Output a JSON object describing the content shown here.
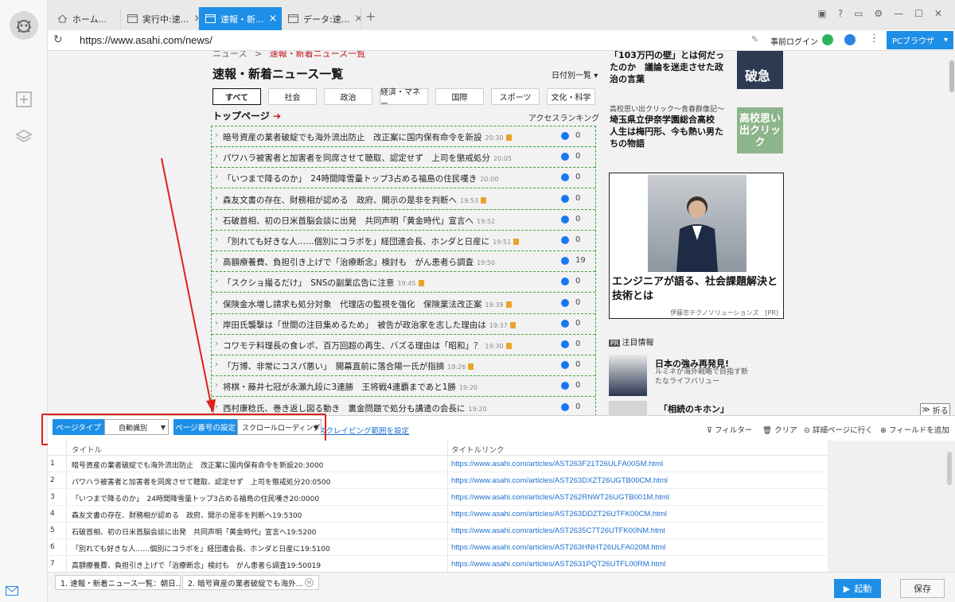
{
  "browser": {
    "tabs": [
      {
        "label": "ホーム..."
      },
      {
        "label": "実行中:速..."
      },
      {
        "label": "速報・新..."
      },
      {
        "label": "データ:速..."
      }
    ],
    "url": "https://www.asahi.com/news/",
    "login_label": "事前ログイン",
    "browser_mode_label": "PCブラウザ"
  },
  "page": {
    "breadcrumb": "ニュース",
    "breadcrumb_sep": ">",
    "breadcrumb_current": "速報・新着ニュース一覧",
    "title": "速報・新着ニュース一覧",
    "date_select": "日付別一覧",
    "categories": [
      "すべて",
      "社会",
      "政治",
      "経済・マネー",
      "国際",
      "スポーツ",
      "文化・科学"
    ],
    "top_heading": "トップページ",
    "access_ranking": "アクセスランキング",
    "news": [
      {
        "title": "暗号資産の業者破綻でも海外流出防止　改正案に国内保有命令を新設",
        "time": "20:30",
        "lock": true,
        "count": "0"
      },
      {
        "title": "パワハラ被害者と加害者を同席させて聴取、認定せず　上司を懲戒処分",
        "time": "20:05",
        "lock": false,
        "count": "0"
      },
      {
        "title": "「いつまで降るのか」　24時間降雪量トップ3占める福島の住民嘆き",
        "time": "20:00",
        "lock": false,
        "count": "0"
      },
      {
        "title": "森友文書の存在、財務相が認める　政府、開示の是非を判断へ",
        "time": "19:53",
        "lock": true,
        "count": "0"
      },
      {
        "title": "石破首相、初の日米首脳会談に出発　共同声明「黄金時代」宣言へ",
        "time": "19:52",
        "lock": false,
        "count": "0"
      },
      {
        "title": "「別れても好きな人……個別にコラボを」経団連会長、ホンダと日産に",
        "time": "19:51",
        "lock": true,
        "count": "0"
      },
      {
        "title": "高額療養費、負担引き上げで「治療断念」検討も　がん患者ら調査",
        "time": "19:50",
        "lock": false,
        "count": "19"
      },
      {
        "title": "「スクショ撮るだけ」　SNSの副業広告に注意",
        "time": "19:45",
        "lock": true,
        "count": "0"
      },
      {
        "title": "保険金水増し請求も処分対象　代理店の監視を強化　保険業法改正案",
        "time": "19:39",
        "lock": true,
        "count": "0"
      },
      {
        "title": "岸田氏襲撃は「世間の注目集めるため」　被告が政治家を志した理由は",
        "time": "19:37",
        "lock": true,
        "count": "0"
      },
      {
        "title": "コワモテ料理長の食レポ、百万回超の再生、バズる理由は「昭和」？",
        "time": "19:30",
        "lock": true,
        "count": "0"
      },
      {
        "title": "「万博、非常にコスパ悪い」　開幕直前に落合陽一氏が指摘",
        "time": "19:26",
        "lock": true,
        "count": "0"
      },
      {
        "title": "将棋・藤井七冠が永瀬九段に3連勝　王将戦4連覇まであと1勝",
        "time": "19:20",
        "lock": false,
        "count": "0"
      },
      {
        "title": "西村康稔氏、巻き返し図る動き　裏金問題で処分も講遣の会長に",
        "time": "19:20",
        "lock": false,
        "count": "0"
      }
    ],
    "right": {
      "article1": "「103万円の壁」とは何だったのか　議論を迷走させた政治の言葉",
      "article1_img": "破急",
      "article2_series": "高校思い出クリック〜青春群像記〜",
      "article2": "埼玉県立伊奈学園総合高校　人生は梅円形、今も熱い男たちの物語",
      "article2_img": "高校思い出クリック",
      "ad_headline": "エンジニアが語る、社会課題解決と技術とは",
      "ad_sponsor": "伊藤忠テクノソリューションズ　[PR]",
      "pr_badge": "PR",
      "pr_label": "注目情報",
      "pr1_title": "日本の強み再発見!",
      "pr1_sub": "ルミネが海外戦略で目指す新たなライフバリュー",
      "pr2_title": "「相続のキホン」",
      "fold_label": "折る"
    }
  },
  "config": {
    "page_type_label": "ページタイプ",
    "page_type_value": "自動識別",
    "page_number_label": "ページ番号の設定",
    "page_number_value": "スクロールローディング",
    "scraping_range": "スクレイピング範囲を設定",
    "filter": "フィルター",
    "clear": "クリア",
    "goto_detail": "詳細ページに行く",
    "add_field": "フィールドを追加"
  },
  "table": {
    "col_title": "タイトル",
    "col_link": "タイトルリンク",
    "rows": [
      {
        "no": "1",
        "title": "暗号資産の業者破綻でも海外流出防止　改正案に国内保有命令を新設20:3000",
        "link": "https://www.asahi.com/articles/AST263F21T26ULFA00SM.html"
      },
      {
        "no": "2",
        "title": "パワハラ被害者と加害者を同席させて聴取、認定せず　上司を懲戒処分20:0500",
        "link": "https://www.asahi.com/articles/AST263DXZT26UGTB00CM.html"
      },
      {
        "no": "3",
        "title": "「いつまで降るのか」　24時間降雪量トップ3占める福島の住民嘆き20:0000",
        "link": "https://www.asahi.com/articles/AST262RNWT26UGTB001M.html"
      },
      {
        "no": "4",
        "title": "森友文書の存在、財務相が認める　政府、開示の是非を判断へ19:5300",
        "link": "https://www.asahi.com/articles/AST263DDZT26UTFK00CM.html"
      },
      {
        "no": "5",
        "title": "石破首相、初の日米首脳会談に出発　共同声明「黄金時代」宣言へ19:5200",
        "link": "https://www.asahi.com/articles/AST2635C7T26UTFK00NM.html"
      },
      {
        "no": "6",
        "title": "「別れても好きな人……個別にコラボを」経団連会長、ホンダと日産に19:5100",
        "link": "https://www.asahi.com/articles/AST263HNHT26ULFA020M.html"
      },
      {
        "no": "7",
        "title": "高額療養費、負担引き上げで「治療断念」検討も　がん患者ら調査19:50019",
        "link": "https://www.asahi.com/articles/AST2631PQT26UTFL00RM.html"
      }
    ]
  },
  "footer": {
    "tab1": "1. 速報・新着ニュース一覧：朝日...",
    "tab2": "2. 暗号資産の業者破綻でも海外...",
    "run": "起動",
    "save": "保存"
  },
  "colors": {
    "accent": "#1e8fe6",
    "highlight": "#e0201c",
    "selection_border": "#3aa63a"
  }
}
